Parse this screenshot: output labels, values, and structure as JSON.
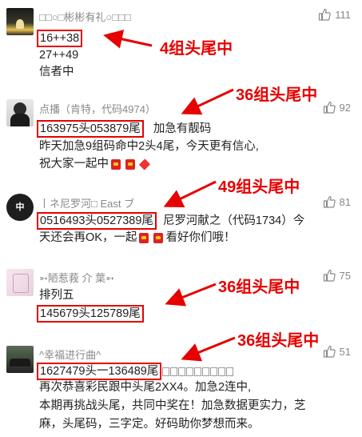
{
  "comments": [
    {
      "username": "□□○□彬彬有礼○□□□",
      "likes": "111",
      "lines": [
        "16++38",
        "27++49",
        "信者中"
      ],
      "annotation": "4组头尾中"
    },
    {
      "username": "点播（肯特，代码4974）",
      "likes": "92",
      "highlight": "163975头053879尾",
      "line1_rest": "加急有靓码",
      "line2": "昨天加急9组码命中2头4尾，今天更有信心,",
      "line3": "祝大家一起中",
      "annotation": "36组头尾中"
    },
    {
      "username": "丨ネ尼罗河□ East ブ",
      "likes": "81",
      "highlight": "0516493头0527389尾",
      "line1_rest": "尼罗河献之（代码1734）今",
      "line2_a": "天还会再OK，一起",
      "line2_b": "看好你们哦！",
      "annotation": "49组头尾中"
    },
    {
      "username": "➳陋惹莪 介 葉➳",
      "likes": "75",
      "line1": "排列五",
      "highlight": "145679头125789尾",
      "annotation": "36组头尾中"
    },
    {
      "username": "^幸福进行曲^",
      "likes": "51",
      "highlight": "1627479头一136489尾",
      "line2": "再次恭喜彩民跟中头尾2XX4。加急2连中,",
      "line3": "本期再挑战头尾，共同中奖在！加急数据更实力，芝",
      "line4": "麻，头尾码，三字定。好码助你梦想而来。",
      "annotation": "36组头尾中"
    }
  ],
  "colors": {
    "highlight_border": "#e60000",
    "annotation": "#e60000",
    "text": "#222222",
    "meta": "#888888"
  }
}
